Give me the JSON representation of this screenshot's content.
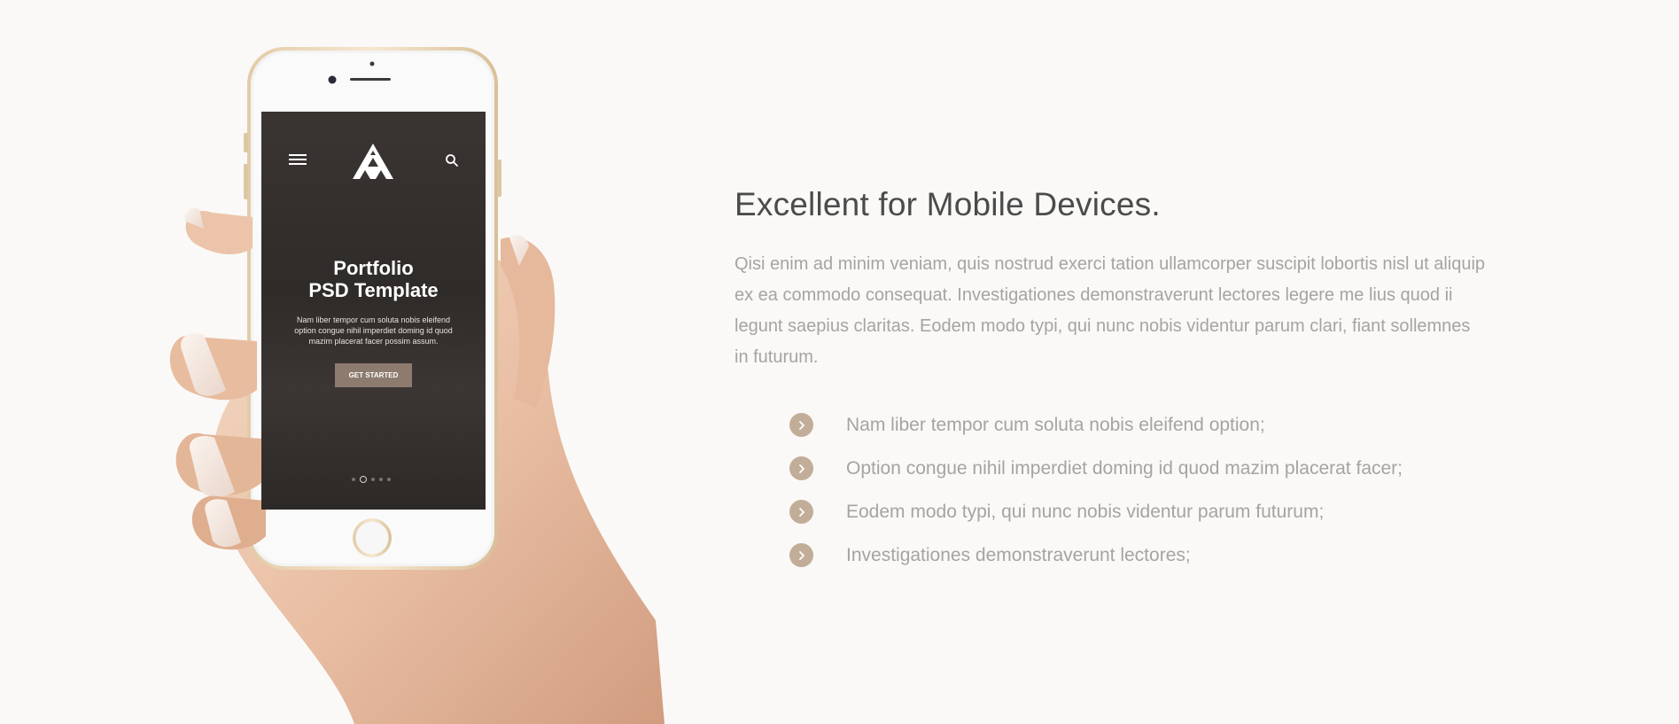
{
  "phone": {
    "title": "Portfolio\nPSD Template",
    "title_line1": "Portfolio",
    "title_line2": "PSD Template",
    "text": "Nam liber tempor cum soluta nobis eleifend option congue nihil imperdiet doming id quod mazim placerat facer possim assum.",
    "button": "GET STARTED",
    "slides": 5,
    "active_slide": 2
  },
  "main": {
    "heading": "Excellent for Mobile Devices.",
    "description": "Qisi enim ad minim veniam, quis nostrud exerci tation ullamcorper suscipit lobortis nisl ut aliquip ex ea commodo consequat. Investigationes demonstraverunt lectores legere me lius quod ii legunt saepius claritas. Eodem modo typi, qui nunc nobis videntur parum clari, fiant sollemnes in futurum.",
    "features": [
      "Nam liber tempor cum soluta nobis eleifend option;",
      "Option congue nihil imperdiet doming id quod mazim placerat facer;",
      "Eodem modo typi, qui nunc nobis videntur parum futurum;",
      "Investigationes demonstraverunt lectores;"
    ]
  },
  "colors": {
    "background": "#faf9f7",
    "heading": "#4b4b4b",
    "body_text": "#a7a3a0",
    "accent": "#c2ad98",
    "phone_button": "#8d7b6f"
  },
  "icons": {
    "bullet": "chevron-right-icon",
    "screen_menu": "hamburger-menu-icon",
    "screen_logo": "triangle-logo-icon",
    "screen_search": "search-icon"
  }
}
